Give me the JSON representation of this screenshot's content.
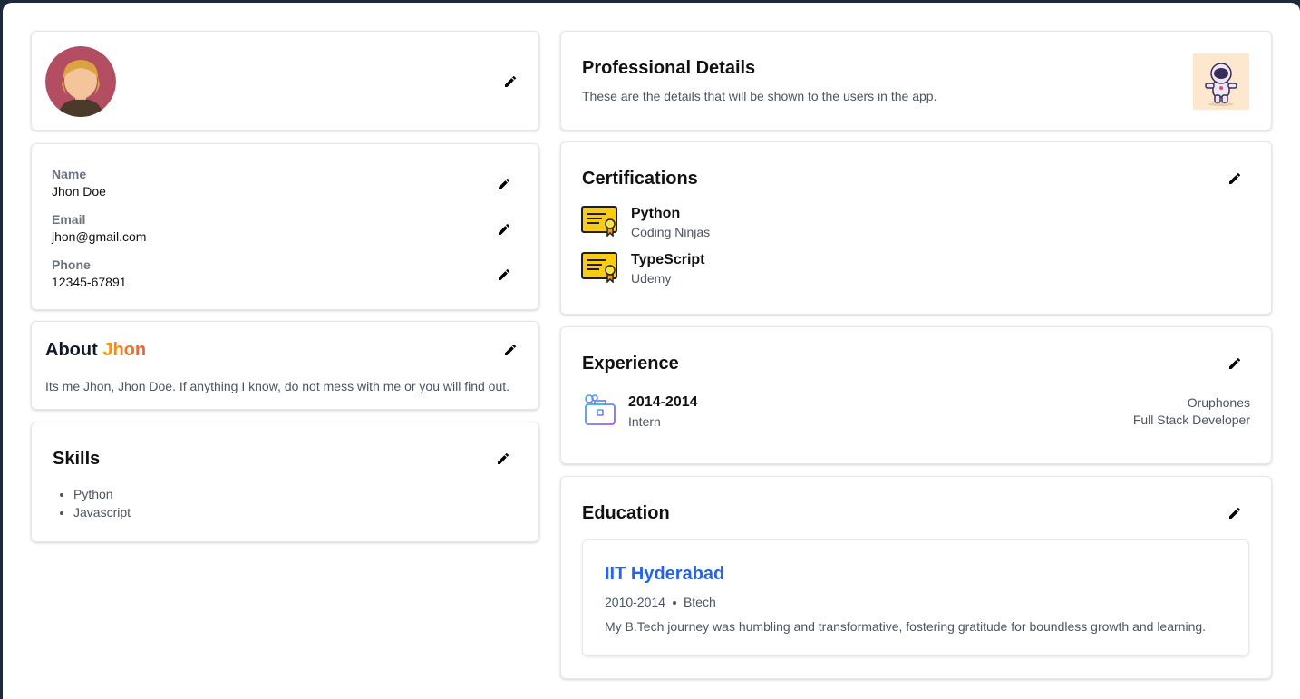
{
  "profile": {
    "name_label": "Name",
    "name_value": "Jhon Doe",
    "email_label": "Email",
    "email_value": "jhon@gmail.com",
    "phone_label": "Phone",
    "phone_value": "12345-67891"
  },
  "about": {
    "title": "About",
    "title_accent": "Jhon",
    "text": "Its me Jhon, Jhon Doe. If anything I know, do not mess with me or you will find out."
  },
  "skills": {
    "title": "Skills",
    "items": [
      "Python",
      "Javascript"
    ]
  },
  "professional": {
    "title": "Professional Details",
    "subtitle": "These are the details that will be shown to the users in the app."
  },
  "certifications": {
    "title": "Certifications",
    "items": [
      {
        "name": "Python",
        "issuer": "Coding Ninjas"
      },
      {
        "name": "TypeScript",
        "issuer": "Udemy"
      }
    ]
  },
  "experience": {
    "title": "Experience",
    "items": [
      {
        "period": "2014-2014",
        "type": "Intern",
        "company": "Oruphones",
        "role": "Full Stack Developer"
      }
    ]
  },
  "education": {
    "title": "Education",
    "items": [
      {
        "school": "IIT Hyderabad",
        "period": "2010-2014",
        "degree": "Btech",
        "description": "My B.Tech journey was humbling and transformative, fostering gratitude for boundless growth and learning."
      }
    ]
  },
  "colors": {
    "accent_link": "#2563eb",
    "accent_gradient_start": "#f59e0b",
    "accent_gradient_end": "#ef5b3a",
    "cert_icon": "#facc15"
  },
  "icons": {
    "edit": "pencil-icon",
    "certificate": "certificate-icon",
    "experience": "briefcase-icon",
    "avatar": "avatar-illustration",
    "professional": "astronaut-illustration"
  }
}
